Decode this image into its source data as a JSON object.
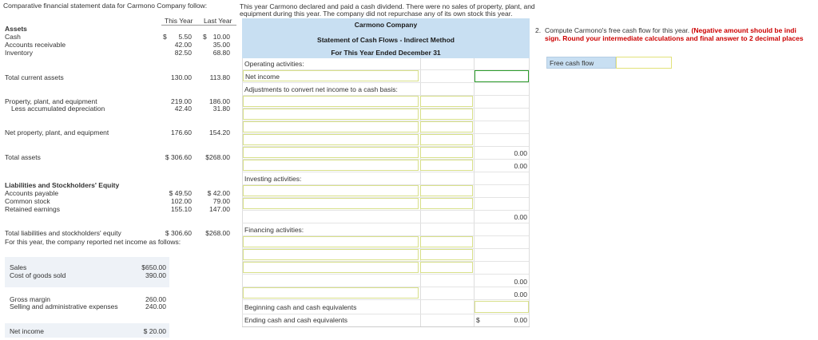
{
  "left": {
    "intro": "Comparative financial statement data for Carmono Company follow:",
    "col_this_year": "This Year",
    "col_last_year": "Last Year",
    "assets_header": "Assets",
    "rows": [
      {
        "label": "Cash",
        "cur_sym": "$",
        "ty": "5.50",
        "ly_sym": "$",
        "ly": "10.00"
      },
      {
        "label": "Accounts receivable",
        "ty": "42.00",
        "ly": "35.00"
      },
      {
        "label": "Inventory",
        "ty": "82.50",
        "ly": "68.80"
      }
    ],
    "total_current_assets": {
      "label": "Total current assets",
      "ty": "130.00",
      "ly": "113.80"
    },
    "ppe": {
      "label": "Property, plant, and equipment",
      "ty": "219.00",
      "ly": "186.00"
    },
    "accum_dep": {
      "label": "Less accumulated depreciation",
      "ty": "42.40",
      "ly": "31.80"
    },
    "net_ppe": {
      "label": "Net property, plant, and equipment",
      "ty": "176.60",
      "ly": "154.20"
    },
    "total_assets": {
      "label": "Total assets",
      "ty": "$ 306.60",
      "ly": "$268.00"
    },
    "liab_header": "Liabilities and Stockholders' Equity",
    "liab_rows": [
      {
        "label": "Accounts payable",
        "ty": "$  49.50",
        "ly": "$  42.00"
      },
      {
        "label": "Common stock",
        "ty": "102.00",
        "ly": "79.00"
      },
      {
        "label": "Retained earnings",
        "ty": "155.10",
        "ly": "147.00"
      }
    ],
    "total_liab": {
      "label": "Total liabilities and stockholders' equity",
      "ty": "$ 306.60",
      "ly": "$268.00"
    },
    "income_intro": "For this year, the company reported net income as follows:",
    "sales": {
      "label": "Sales",
      "val": "$650.00"
    },
    "cogs": {
      "label": "Cost of goods sold",
      "val": "390.00"
    },
    "gross": {
      "label": "Gross margin",
      "val": "260.00"
    },
    "sga": {
      "label": "Selling and administrative expenses",
      "val": "240.00"
    },
    "net_income": {
      "label": "Net income",
      "val": "$  20.00"
    }
  },
  "middle": {
    "intro1": "This year Carmono declared and paid a cash dividend. There were no sales of property, plant, and",
    "intro2": "equipment during this year. The company did not repurchase any of its own stock this year.",
    "company": "Carmono Company",
    "statement": "Statement of Cash Flows - Indirect Method",
    "period": "For This Year Ended December 31",
    "operating": "Operating activities:",
    "net_income": "Net income",
    "adjustments": "Adjustments to convert net income to a cash basis:",
    "zero_a": "0.00",
    "zero_b": "0.00",
    "investing": "Investing activities:",
    "zero_c": "0.00",
    "financing": "Financing activities:",
    "zero_d": "0.00",
    "zero_e": "0.00",
    "beginning": "Beginning cash and cash equivalents",
    "ending": "Ending cash and cash equivalents",
    "ending_sym": "$",
    "ending_val": "0.00"
  },
  "right": {
    "question_num": "2.",
    "question": "Compute Carmono's free cash flow for this year.",
    "note1": "(Negative amount should be indi",
    "note2": "sign. Round your intermediate calculations and final answer to 2 decimal places",
    "fcf_label": "Free cash flow"
  }
}
